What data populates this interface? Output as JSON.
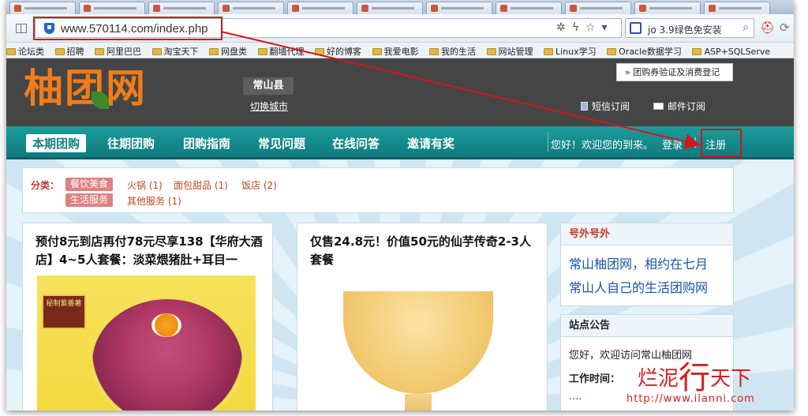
{
  "browser": {
    "address_url": "www.570114.com/index.php",
    "search_engine_text": "jo 3.9绿色免安装",
    "bookmarks": [
      "论坛类",
      "招聘",
      "阿里巴巴",
      "淘宝天下",
      "网盘类",
      "翻墙代理",
      "好的博客",
      "我爱电影",
      "我的生活",
      "网站管理",
      "Linux学习",
      "Oracle数据学习",
      "ASP+SQLServe"
    ]
  },
  "site": {
    "logo_text": "柚团网",
    "city": "常山县",
    "switch_city": "切换城市",
    "voucher_link": "» 团购券验证及消费登记",
    "sms_subscribe": "短信订阅",
    "mail_subscribe": "邮件订阅"
  },
  "nav": {
    "items": [
      "本期团购",
      "往期团购",
      "团购指南",
      "常见问题",
      "在线问答",
      "邀请有奖"
    ],
    "greeting": "您好！欢迎您的到来。",
    "login": "登录",
    "separator": "|",
    "register": "注册"
  },
  "categories": {
    "label": "分类：",
    "tag_food": "餐饮美食",
    "tag_life": "生活服务",
    "links": [
      "火锅 (1)",
      "面包甜品 (1)",
      "饭店 (2)"
    ],
    "other": "其他服务 (1)"
  },
  "deals": [
    {
      "title": "预付8元到店再付78元尽享138【华府大酒店】4~5人套餐：淡菜煨猪肚+耳目一",
      "image_sign": "秘制紫番薯"
    },
    {
      "title": "仅售24.8元！价值50元的仙芋传奇2-3人套餐"
    }
  ],
  "sidebar": {
    "extra_title": "号外号外",
    "extra_line1": "常山柚团网，相约在七月",
    "extra_line2": "常山人自己的生活团购网",
    "notice_title": "站点公告",
    "notice_text": "您好，欢迎访问常山柚团网",
    "work_time_label": "工作时间："
  },
  "watermark": {
    "text_1": "烂泥",
    "text_big": "行",
    "text_2": "天下",
    "url": "http://www.ilanni.com"
  },
  "colors": {
    "nav_teal": "#14878b",
    "logo_orange": "#f07d1a",
    "highlight_red": "#d4161c"
  }
}
